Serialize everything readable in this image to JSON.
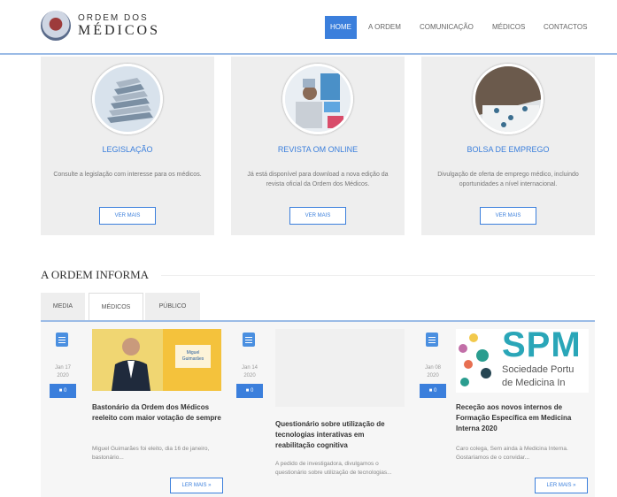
{
  "header": {
    "logo_line1": "ORDEM DOS",
    "logo_line2": "MÉDICOS"
  },
  "nav": {
    "items": [
      "HOME",
      "A ORDEM",
      "COMUNICAÇÃO",
      "MÉDICOS",
      "CONTACTOS"
    ],
    "active": "HOME"
  },
  "cards": [
    {
      "title": "LEGISLAÇÃO",
      "description": "Consulte a legislação com interesse para os médicos.",
      "button": "VER MAIS"
    },
    {
      "title": "REVISTA OM ONLINE",
      "description": "Já está disponível para download a nova edição da revista oficial da Ordem dos Médicos.",
      "button": "VER MAIS"
    },
    {
      "title": "BOLSA DE EMPREGO",
      "description": "Divulgação de oferta de emprego médico, incluindo oportunidades a nível internacional.",
      "button": "VER MAIS"
    }
  ],
  "section": {
    "title": "A ORDEM INFORMA",
    "tabs": [
      "MEDIA",
      "MÉDICOS",
      "PÚBLICO"
    ],
    "active_tab": "MÉDICOS"
  },
  "news": [
    {
      "date_day": "Jan 17",
      "date_year": "2020",
      "comments": "0",
      "image_text": "Miguel Guimarães",
      "title": "Bastonário da Ordem dos Médicos reeleito com maior votação de sempre",
      "excerpt": "Miguel Guimarães foi eleito, dia 16 de janeiro, bastonário...",
      "button": "LER MAIS »"
    },
    {
      "date_day": "Jan 14",
      "date_year": "2020",
      "comments": "0",
      "title": "Questionário sobre utilização de tecnologias interativas em reabilitação cognitiva",
      "excerpt": "A pedido de investigadora, divulgamos o questionário sobre utilização de tecnologias...",
      "button": ""
    },
    {
      "date_day": "Jan 08",
      "date_year": "2020",
      "comments": "0",
      "image_logo": "SPM",
      "image_line1": "Sociedade Portu",
      "image_line2": "de Medicina In",
      "title": "Receção aos novos internos de Formação Específica em Medicina Interna 2020",
      "excerpt": "Caro colega, Sem ainda à Medicina Interna. Gostaríamos de o convidar...",
      "button": "LER MAIS »"
    }
  ],
  "colors": {
    "accent": "#3b7fdc",
    "rule": "#9bbbe6",
    "card_bg": "#eeeeee"
  }
}
